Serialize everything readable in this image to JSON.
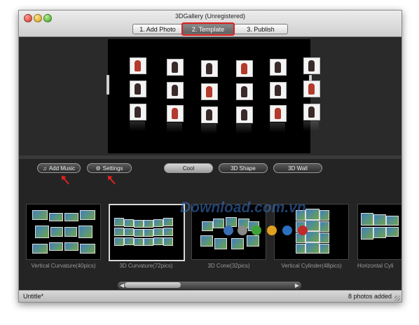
{
  "window": {
    "title": "3DGallery (Unregistered)"
  },
  "steps": [
    {
      "label": "1. Add Photo",
      "state": "normal"
    },
    {
      "label": "2. Template",
      "state": "selected"
    },
    {
      "label": "3. Publish",
      "state": "normal"
    }
  ],
  "toolbar": {
    "add_music": "Add Music",
    "settings": "Settings",
    "filters": [
      "Cool",
      "3D Shape",
      "3D Wall"
    ],
    "active_filter": "Cool"
  },
  "templates": [
    {
      "label": "Vertical Curvature(40pics)"
    },
    {
      "label": "3D Curvature(72pics)",
      "selected": true
    },
    {
      "label": "3D Cone(32pics)"
    },
    {
      "label": "Vertical Cylinder(48pics)"
    },
    {
      "label": "Horizontal Cyli"
    }
  ],
  "watermark": "Download.com.vn",
  "watermark_dot_colors": [
    "#3a6fb3",
    "#8a8a8a",
    "#3fa33a",
    "#e0a020",
    "#2a6fc0",
    "#c02a2a"
  ],
  "status": {
    "left": "Untitle*",
    "right": "8 photos added"
  },
  "colors": {
    "highlight": "#e02020",
    "background": "#1f1f1f"
  }
}
